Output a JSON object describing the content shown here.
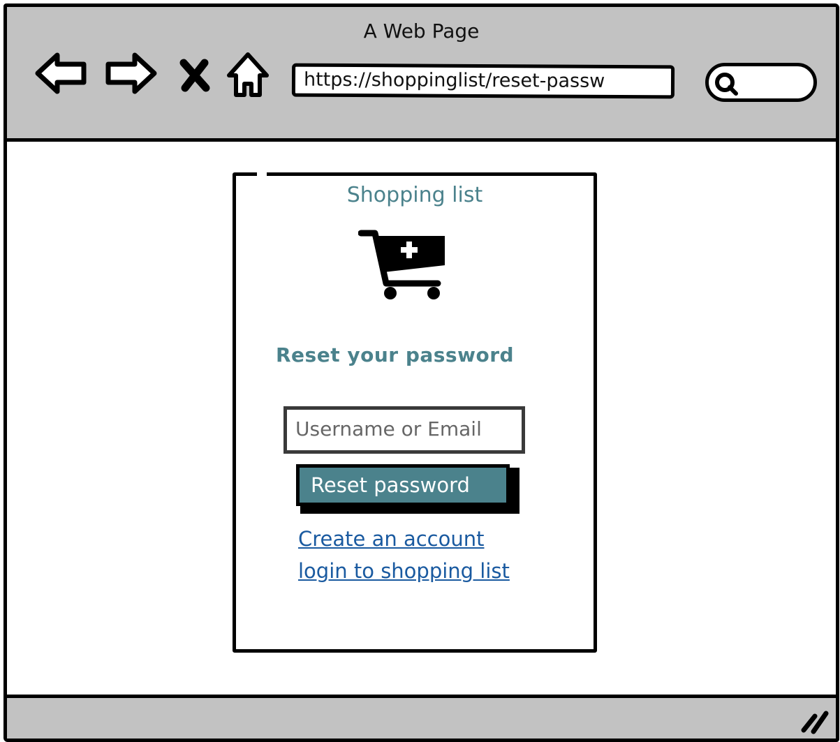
{
  "browser": {
    "window_title": "A Web Page",
    "url": "https://shoppinglist/reset-passw",
    "icons": [
      "back-arrow-icon",
      "forward-arrow-icon",
      "close-x-icon",
      "home-icon",
      "search-icon",
      "resize-grip-icon"
    ]
  },
  "app": {
    "name": "Shopping list",
    "logo_icon": "cart-plus-icon"
  },
  "form": {
    "heading": "Reset your password",
    "username_placeholder": "Username or Email",
    "submit_label": "Reset password"
  },
  "links": {
    "create_account": "Create an account",
    "login": "login to shopping list"
  },
  "colors": {
    "accent": "#4b828c",
    "link": "#1a5aa0",
    "chrome": "#c2c2c2"
  }
}
